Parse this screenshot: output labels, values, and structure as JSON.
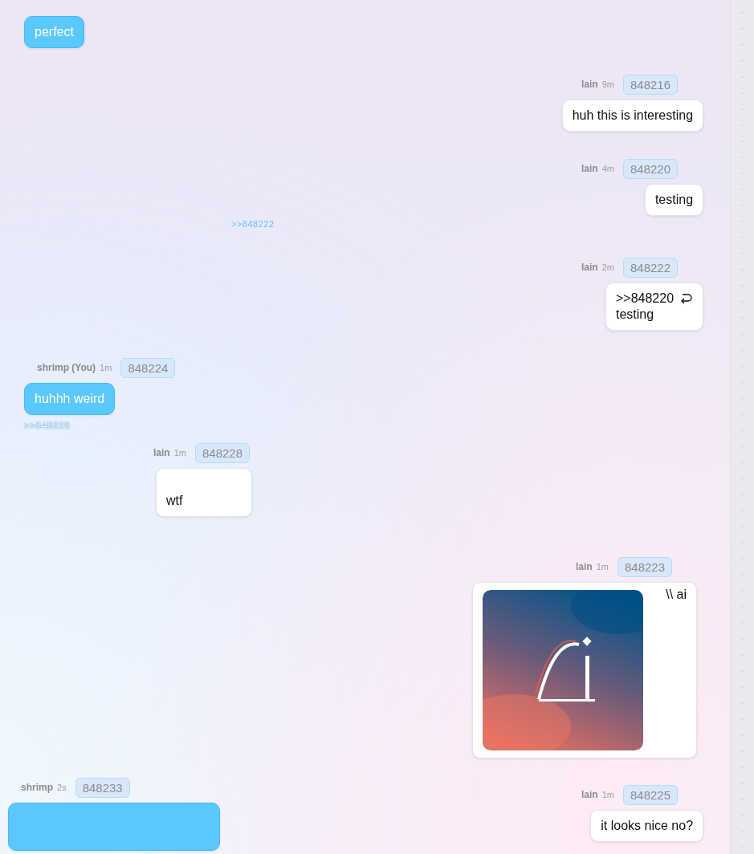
{
  "floating_link": ">>848222",
  "messages": [
    {
      "mine": true,
      "text": "perfect"
    },
    {
      "author": "lain",
      "time": "9m",
      "post_id": "848216",
      "mine": false,
      "text": "huh this is interesting"
    },
    {
      "author": "lain",
      "time": "4m",
      "post_id": "848220",
      "mine": false,
      "text": "testing"
    },
    {
      "author": "lain",
      "time": "2m",
      "post_id": "848222",
      "mine": false,
      "quote": ">>848220",
      "text": "testing"
    },
    {
      "author": "shrimp (You)",
      "time": "1m",
      "post_id": "848224",
      "mine": true,
      "text": "huhhh weird",
      "backlink": ">>848228"
    },
    {
      "author": "lain",
      "time": "1m",
      "post_id": "848228",
      "mine": false,
      "text": "wtf"
    },
    {
      "author": "lain",
      "time": "1m",
      "post_id": "848223",
      "mine": false,
      "text": "\\\\ ai"
    },
    {
      "author": "shrimp",
      "time": "2s",
      "post_id": "848233",
      "mine": true
    },
    {
      "author": "lain",
      "time": "1m",
      "post_id": "848225",
      "mine": false,
      "text": "it looks nice no?"
    }
  ]
}
